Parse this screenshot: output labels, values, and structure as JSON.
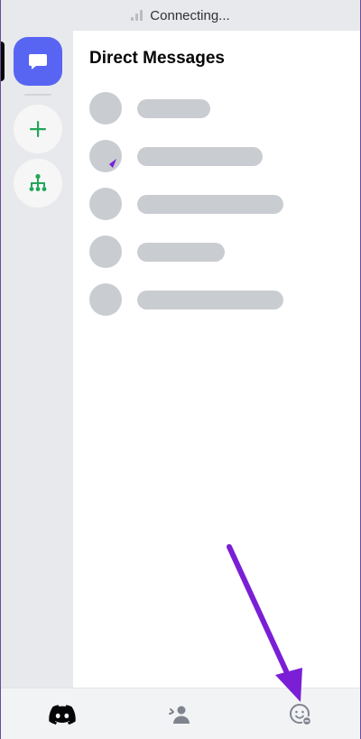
{
  "status": {
    "text": "Connecting..."
  },
  "main": {
    "title": "Direct Messages"
  },
  "skeleton_rows": [
    {
      "bar_fraction": 0.5
    },
    {
      "bar_fraction": 0.86
    },
    {
      "bar_fraction": 1.0
    },
    {
      "bar_fraction": 0.6
    },
    {
      "bar_fraction": 1.0
    }
  ],
  "icons": {
    "dm": "chat-bubble-icon",
    "add": "plus-icon",
    "discover": "hierarchy-icon",
    "home": "discord-logo-icon",
    "friends": "friends-wave-icon",
    "profile": "profile-smiley-icon"
  },
  "colors": {
    "accent": "#5865f2",
    "green": "#23a55a",
    "annotation": "#7a1fd6",
    "skeleton": "#c9ccd1"
  }
}
